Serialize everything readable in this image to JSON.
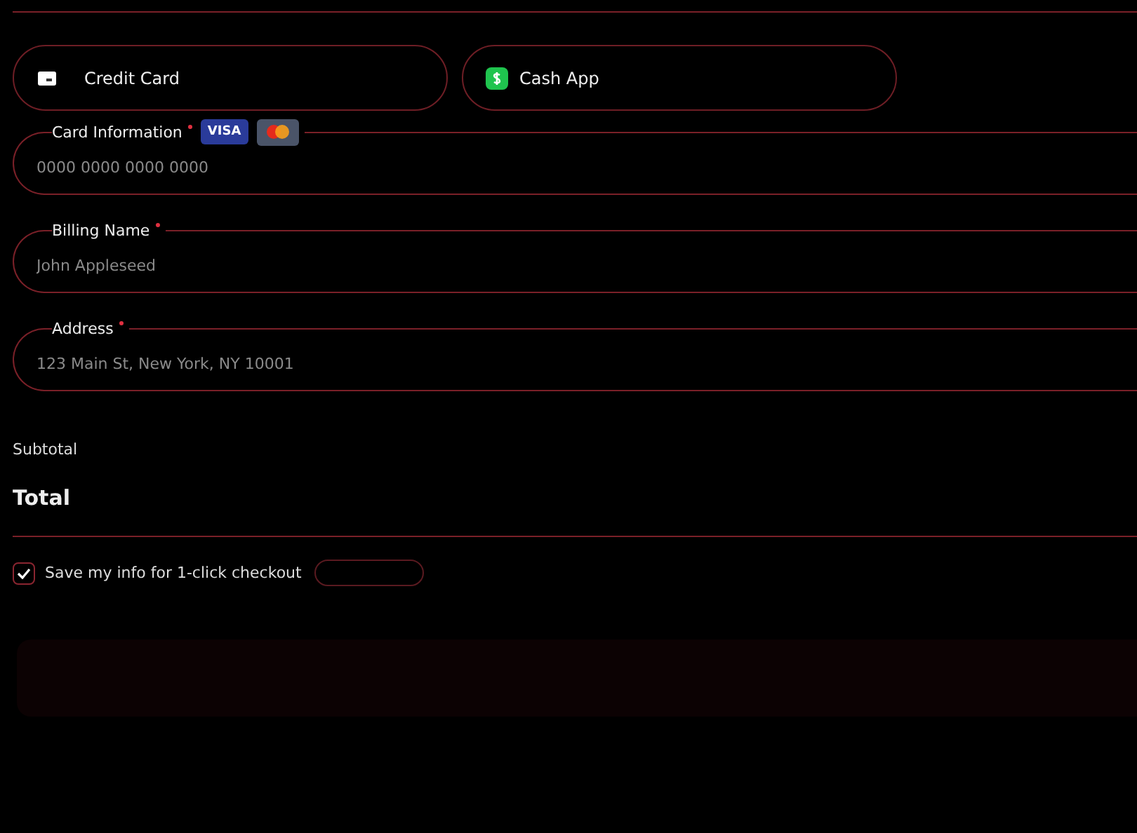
{
  "payment_methods": [
    {
      "label": "Credit Card",
      "kind": "card",
      "selected": false
    },
    {
      "label": "Cash App",
      "kind": "cashapp",
      "selected": false
    }
  ],
  "fields": [
    {
      "label": "Card Information",
      "required": true,
      "placeholder": "0000 0000 0000 0000",
      "badges": [
        {
          "kind": "visa",
          "text": "VISA"
        },
        {
          "kind": "mastercard"
        }
      ]
    },
    {
      "label": "Billing Name",
      "required": true,
      "placeholder": "John Appleseed"
    },
    {
      "label": "Address",
      "required": true,
      "placeholder": "123 Main St, New York, NY 10001"
    }
  ],
  "summary": {
    "subtotal_label": "Subtotal",
    "total_label": "Total"
  },
  "save_info": {
    "label": "Save my info for 1-click checkout",
    "checked": true
  }
}
